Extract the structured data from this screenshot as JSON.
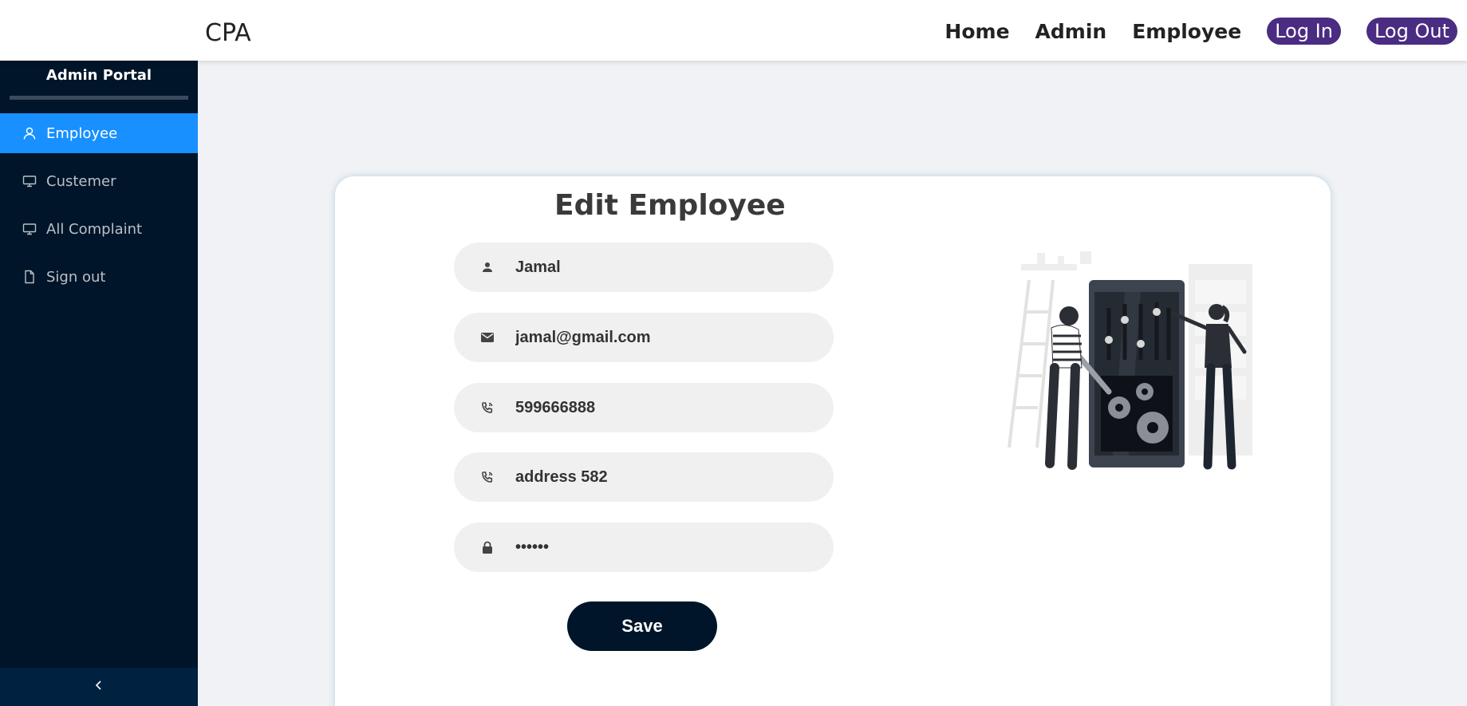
{
  "header": {
    "brand": "CPA",
    "nav": {
      "home": "Home",
      "admin": "Admin",
      "employee": "Employee",
      "login": "Log In",
      "logout": "Log Out"
    }
  },
  "sidebar": {
    "title": "Admin Portal",
    "items": [
      {
        "label": "Employee",
        "icon": "user-icon",
        "active": true
      },
      {
        "label": "Custemer",
        "icon": "desktop-icon",
        "active": false
      },
      {
        "label": "All Complaint",
        "icon": "desktop-icon",
        "active": false
      },
      {
        "label": "Sign out",
        "icon": "file-icon",
        "active": false
      }
    ],
    "collapse_icon": "chevron-left-icon"
  },
  "form": {
    "title": "Edit Employee",
    "fields": {
      "name": {
        "value": "Jamal",
        "icon": "person-icon"
      },
      "email": {
        "value": "jamal@gmail.com",
        "icon": "mail-icon"
      },
      "phone": {
        "value": "599666888",
        "icon": "phone-icon"
      },
      "address": {
        "value": "address 582",
        "icon": "phone-icon"
      },
      "password": {
        "value": "••••••",
        "icon": "lock-icon"
      }
    },
    "save_label": "Save"
  },
  "colors": {
    "sidebar_bg": "#001529",
    "active_item": "#1890ff",
    "nav_pill": "#4a2c82",
    "save_button": "#001529"
  }
}
